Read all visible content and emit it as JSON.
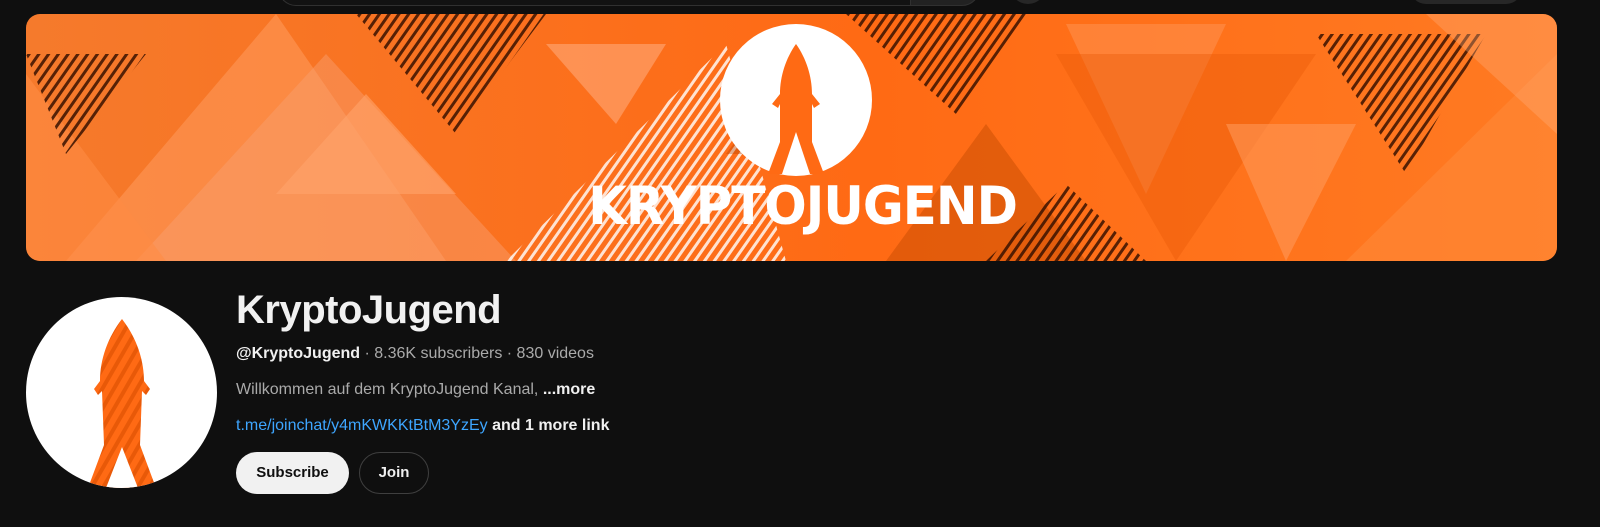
{
  "banner": {
    "title": "KRYPTOJUGEND",
    "logo": "rocket-icon"
  },
  "channel": {
    "name": "KryptoJugend",
    "handle": "@KryptoJugend",
    "subscribers": "8.36K subscribers",
    "videos": "830 videos",
    "separator": " · ",
    "description": "Willkommen auf dem KryptoJugend Kanal, ",
    "more_label": "...more",
    "link_text": "t.me/joinchat/y4mKWKKtBtM3YzEy",
    "more_links_label": "and 1 more link"
  },
  "buttons": {
    "subscribe": "Subscribe",
    "join": "Join"
  },
  "colors": {
    "background": "#0f0f0f",
    "brand_orange": "#ff6a14",
    "link_blue": "#3ea6ff",
    "subscribe_bg": "#f1f1f1"
  }
}
